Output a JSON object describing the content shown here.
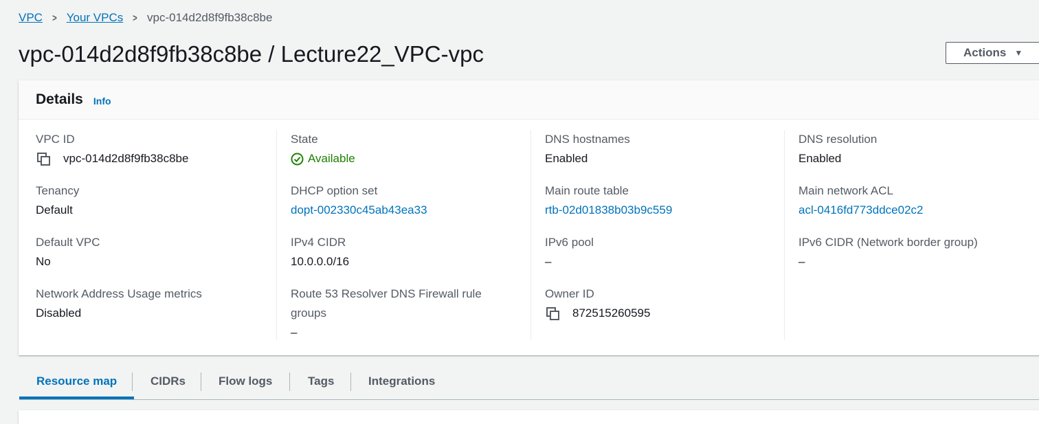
{
  "breadcrumb": {
    "items": [
      "VPC",
      "Your VPCs"
    ],
    "current": "vpc-014d2d8f9fb38c8be"
  },
  "page": {
    "title": "vpc-014d2d8f9fb38c8be / Lecture22_VPC-vpc",
    "actions_label": "Actions"
  },
  "details": {
    "title": "Details",
    "info_label": "Info",
    "fields": {
      "vpc_id": {
        "label": "VPC ID",
        "value": "vpc-014d2d8f9fb38c8be"
      },
      "state": {
        "label": "State",
        "value": "Available"
      },
      "dns_hostnames": {
        "label": "DNS hostnames",
        "value": "Enabled"
      },
      "dns_resolution": {
        "label": "DNS resolution",
        "value": "Enabled"
      },
      "tenancy": {
        "label": "Tenancy",
        "value": "Default"
      },
      "dhcp_option_set": {
        "label": "DHCP option set",
        "value": "dopt-002330c45ab43ea33"
      },
      "main_route_table": {
        "label": "Main route table",
        "value": "rtb-02d01838b03b9c559"
      },
      "main_network_acl": {
        "label": "Main network ACL",
        "value": "acl-0416fd773ddce02c2"
      },
      "default_vpc": {
        "label": "Default VPC",
        "value": "No"
      },
      "ipv4_cidr": {
        "label": "IPv4 CIDR",
        "value": "10.0.0.0/16"
      },
      "ipv6_pool": {
        "label": "IPv6 pool",
        "value": "–"
      },
      "ipv6_cidr": {
        "label": "IPv6 CIDR (Network border group)",
        "value": "–"
      },
      "nau_metrics": {
        "label": "Network Address Usage metrics",
        "value": "Disabled"
      },
      "route53": {
        "label_line1": "Route 53 Resolver DNS Firewall rule",
        "label_line2": "groups",
        "value": "–"
      },
      "owner_id": {
        "label": "Owner ID",
        "value": "872515260595"
      }
    }
  },
  "tabs": [
    "Resource map",
    "CIDRs",
    "Flow logs",
    "Tags",
    "Integrations"
  ],
  "colors": {
    "link": "#0073bb",
    "success": "#1d8102",
    "text": "#16191f",
    "muted": "#545b64",
    "background": "#f2f3f3"
  },
  "icons": {
    "copy": "copy-icon",
    "status": "check-circle-icon",
    "dropdown": "caret-down-icon"
  }
}
